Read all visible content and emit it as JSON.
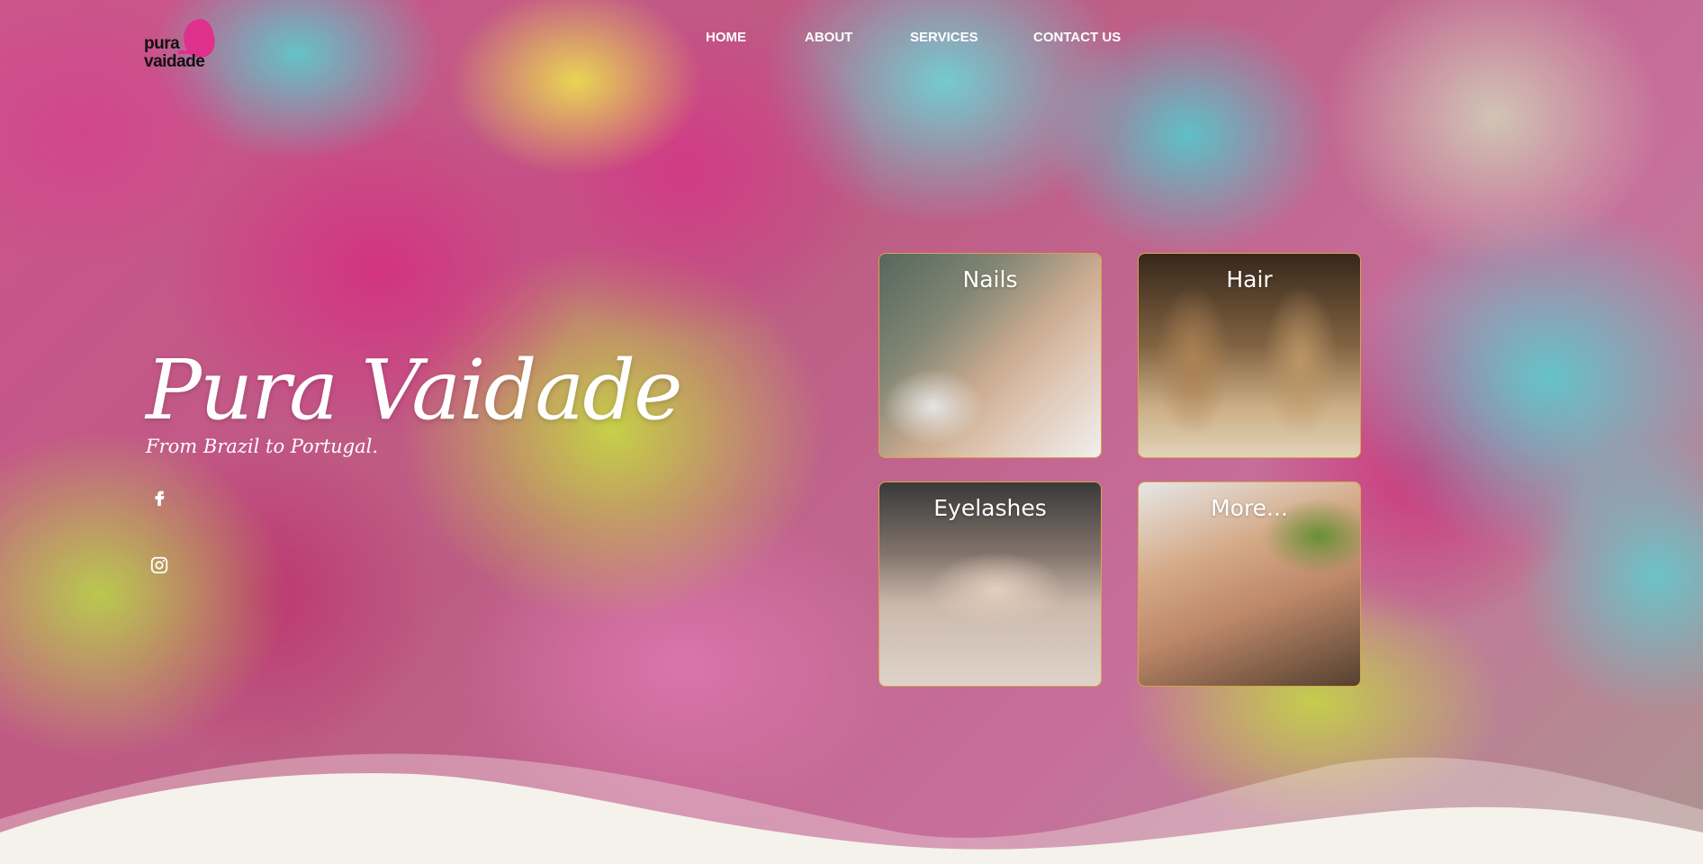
{
  "logo": {
    "line1": "pura",
    "line2": "vaidade"
  },
  "nav": {
    "home": "HOME",
    "about": "ABOUT",
    "services": "SERVICES",
    "contact": "CONTACT US"
  },
  "hero": {
    "title": "Pura Vaidade",
    "subtitle": "From Brazil to Portugal."
  },
  "social": {
    "facebook": "facebook-icon",
    "instagram": "instagram-icon"
  },
  "services": [
    {
      "label": "Nails"
    },
    {
      "label": "Hair"
    },
    {
      "label": "Eyelashes"
    },
    {
      "label": "More..."
    }
  ],
  "colors": {
    "brand_pink": "#e0308d",
    "card_border": "#d7a648",
    "wave": "#f5f2eb"
  }
}
